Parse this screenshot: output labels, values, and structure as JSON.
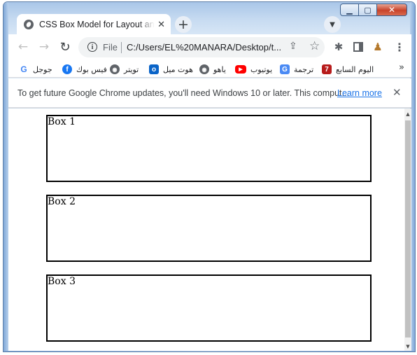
{
  "window": {
    "minimize_glyph": "▁",
    "maximize_glyph": "▢",
    "close_glyph": "✕"
  },
  "tab": {
    "title": "CSS Box Model for Layout and Po",
    "favicon": "globe-icon",
    "close_glyph": "✕"
  },
  "new_tab_glyph": "+",
  "tab_search_glyph": "▼",
  "toolbar": {
    "back_glyph": "←",
    "forward_glyph": "→",
    "reload_glyph": "↻",
    "info_glyph": "i",
    "scheme": "File",
    "url": "C:/Users/EL%20MANARA/Desktop/t...",
    "share_glyph": "⇪",
    "star_glyph": "☆",
    "puzzle_glyph": "✱",
    "profile_glyph": "♟",
    "menu_glyph": "⋮"
  },
  "bookmarks": [
    {
      "label": "جوجل",
      "icon": "G",
      "icon_color": "#4285f4",
      "icon_name": "google-icon"
    },
    {
      "label": "فيس بوك",
      "icon": "f",
      "icon_color": "#1877f2",
      "icon_name": "facebook-icon"
    },
    {
      "label": "تويتر",
      "icon": "◉",
      "icon_color": "#5f6368",
      "icon_name": "globe-icon"
    },
    {
      "label": "هوت ميل",
      "icon": "o",
      "icon_color": "#0a64c8",
      "icon_name": "outlook-icon"
    },
    {
      "label": "ياهو",
      "icon": "◉",
      "icon_color": "#5f6368",
      "icon_name": "globe-icon"
    },
    {
      "label": "يوتيوب",
      "icon": "▶",
      "icon_color": "#ff0000",
      "icon_name": "youtube-icon"
    },
    {
      "label": "ترجمة",
      "icon": "G",
      "icon_color": "#4a8af4",
      "icon_name": "translate-icon"
    },
    {
      "label": "اليوم السابع",
      "icon": "7",
      "icon_color": "#b71c1c",
      "icon_name": "youm7-icon"
    }
  ],
  "bookmarks_overflow": "»",
  "infobar": {
    "message": "To get future Google Chrome updates, you'll need Windows 10 or later. This comput...",
    "link": "Learn more",
    "close_glyph": "✕"
  },
  "boxes": [
    {
      "label": "Box 1"
    },
    {
      "label": "Box 2"
    },
    {
      "label": "Box 3"
    }
  ],
  "scrollbar": {
    "up_glyph": "▲",
    "down_glyph": "▼"
  }
}
